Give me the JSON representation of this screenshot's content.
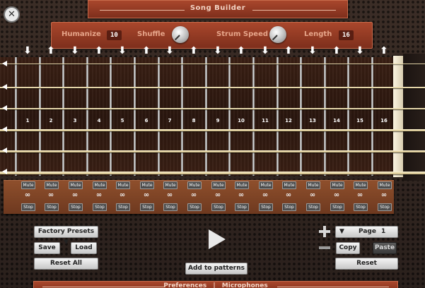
{
  "title": "Song Builder",
  "controls": {
    "humanize_label": "Humanize",
    "humanize_value": "10",
    "shuffle_label": "Shuffle",
    "strum_speed_label": "Strum Speed",
    "length_label": "Length",
    "length_value": "16"
  },
  "strum_directions": [
    "down",
    "up",
    "down",
    "up",
    "down",
    "up",
    "down",
    "up",
    "down",
    "up",
    "down",
    "up",
    "down",
    "up",
    "down",
    "up"
  ],
  "steps": [
    "1",
    "2",
    "3",
    "4",
    "5",
    "6",
    "7",
    "8",
    "9",
    "10",
    "11",
    "12",
    "13",
    "14",
    "15",
    "16"
  ],
  "step_buttons": {
    "mute_label": "Mute",
    "stop_label": "Stop"
  },
  "left_panel": {
    "presets_label": "Factory Presets",
    "save_label": "Save",
    "load_label": "Load",
    "reset_all_label": "Reset All"
  },
  "center": {
    "add_label": "Add to patterns"
  },
  "right_panel": {
    "page_label": "Page",
    "page_value": "1",
    "copy_label": "Copy",
    "paste_label": "Paste",
    "reset_label": "Reset"
  },
  "footer": {
    "preferences_label": "Preferences",
    "separator": "|",
    "microphones_label": "Microphones"
  }
}
